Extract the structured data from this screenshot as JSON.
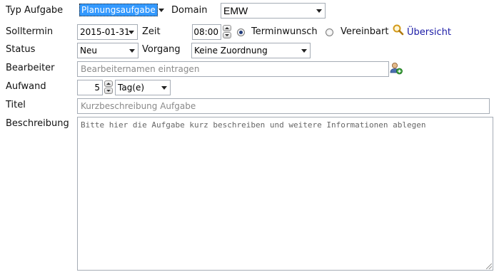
{
  "typ_aufgabe": {
    "label": "Typ Aufgabe",
    "value": "Planungsaufgabe"
  },
  "domain": {
    "label": "Domain",
    "value": "EMW"
  },
  "solltermin": {
    "label": "Solltermin",
    "value": "2015-01-31"
  },
  "zeit": {
    "label": "Zeit",
    "value": "08:00"
  },
  "terminwunsch": {
    "label": "Terminwunsch",
    "selected": true
  },
  "vereinbart": {
    "label": "Vereinbart",
    "selected": false
  },
  "uebersicht": {
    "label": "Übersicht",
    "icon": "magnifier-icon"
  },
  "status": {
    "label": "Status",
    "value": "Neu"
  },
  "vorgang": {
    "label": "Vorgang",
    "value": "Keine Zuordnung"
  },
  "bearbeiter": {
    "label": "Bearbeiter",
    "placeholder": "Bearbeiternamen eintragen",
    "icon": "add-user-icon"
  },
  "aufwand": {
    "label": "Aufwand",
    "value": "5",
    "unit": "Tag(e)"
  },
  "titel": {
    "label": "Titel",
    "placeholder": "Kurzbeschreibung Aufgabe"
  },
  "beschreibung": {
    "label": "Beschreibung",
    "placeholder": "Bitte hier die Aufgabe kurz beschreiben und weitere Informationen ablegen"
  },
  "colors": {
    "highlight": "#3399ff",
    "link": "#1a1aa6",
    "border": "#a5acb5"
  }
}
